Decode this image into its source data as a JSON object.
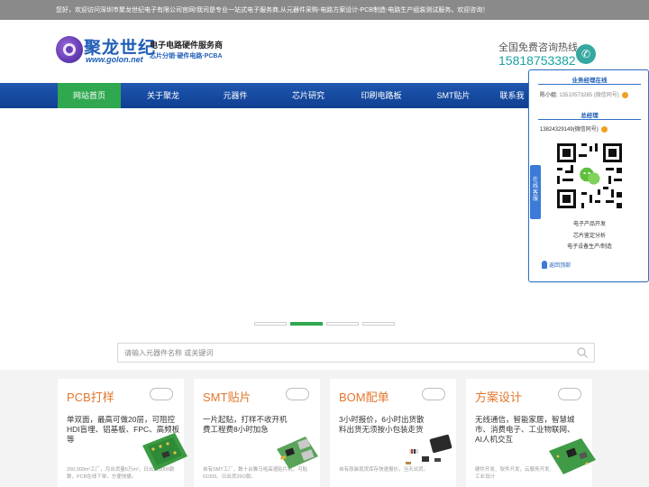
{
  "topbar": {
    "text": "您好，欢迎访问深圳市聚龙世纪电子有限公司官网!我司是专业一站式电子服务商,从元器件采购-电路方案设计-PCB制造-电路生产组装测试服务。欢迎咨询！"
  },
  "header": {
    "logo_cn": "聚龙世纪",
    "logo_en": "www.golon.net",
    "slogan_main": "电子电路硬件服务商",
    "slogan_sub": "芯片分销·硬件电路·PCBA",
    "hotline_label": "全国免费咨询热线",
    "hotline_number": "15818753382"
  },
  "nav": {
    "items": [
      {
        "label": "网站首页"
      },
      {
        "label": "关于聚龙"
      },
      {
        "label": "元器件"
      },
      {
        "label": "芯片研究"
      },
      {
        "label": "印刷电路板"
      },
      {
        "label": "SMT贴片"
      },
      {
        "label": "联系我"
      }
    ]
  },
  "search": {
    "placeholder": "请输入元器件名称 或关键词"
  },
  "cards": [
    {
      "title": "PCB打样",
      "desc": "单双面，最高可做20层，可阻控HDI盲埋、铝基板、FPC、高频板等",
      "foot": "200,000m²工厂，月出货量6万m²，日出货3000款数，PCB在线下单，方便快捷。"
    },
    {
      "title": "SMT贴片",
      "desc": "一片起贴，打样不收开机费工程费8小时加急",
      "foot": "自有SMT工厂，数十台雅马哈高速贴片机，可贴01005、日出货25O款。"
    },
    {
      "title": "BOM配单",
      "desc": "3小时报价，6小时出货散料出货无须按小包装走货",
      "foot": "自有原装现货库存快速报价，当天出货。"
    },
    {
      "title": "方案设计",
      "desc": "无线通信，智能家居，智慧城市、消费电子、工业物联网、AI人机交互",
      "foot": "硬件开发、软件开发，云服务开发、工业设计"
    }
  ],
  "float_panel": {
    "tab_label": "在线客服",
    "section1_title": "业务经理在线",
    "contact1": "陈小姐: ",
    "contact1_phone": "13510573285 (微信同号)",
    "section2_title": "总经理",
    "contact2": "13824329149(微信同号)",
    "links": [
      "电子产品开发",
      "芯片鉴定分析",
      "电子设备生产/制造"
    ],
    "back_top": "返回顶部"
  },
  "colors": {
    "nav": "#1f57b0",
    "nav_active": "#2fa84f",
    "card_title": "#e3762c",
    "brand": "#1f5db8"
  }
}
